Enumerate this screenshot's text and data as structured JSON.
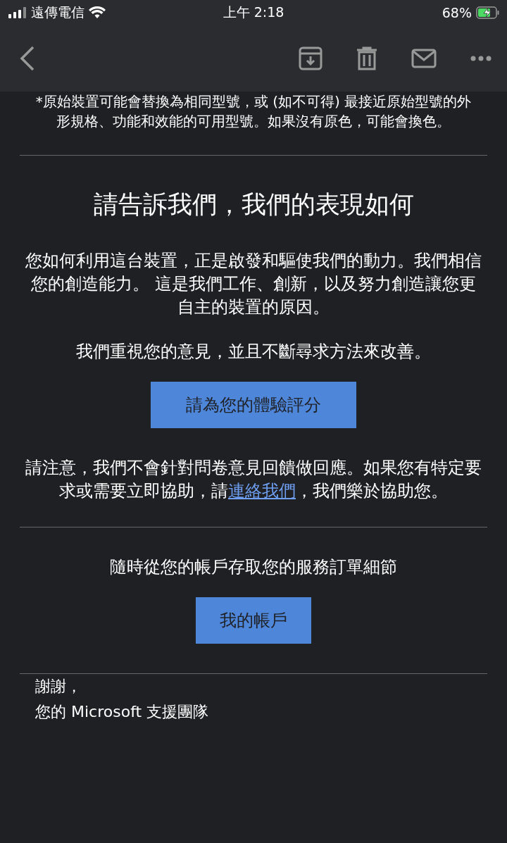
{
  "status_bar": {
    "carrier": "遠傳電信",
    "time": "上午 2:18",
    "battery": "68%"
  },
  "email": {
    "footnote": "*原始裝置可能會替換為相同型號，或 (如不可得) 最接近原始型號的外形規格、功能和效能的可用型號。如果沒有原色，可能會換色。",
    "survey_title": "請告訴我們，我們的表現如何",
    "survey_text": "您如何利用這台裝置，正是啟發和驅使我們的動力。我們相信您的創造能力。 這是我們工作、創新，以及努力創造讓您更自主的裝置的原因。",
    "survey_text_2": "我們重視您的意見，並且不斷尋求方法來改善。",
    "rate_button": "請為您的體驗評分",
    "notice_before": "請注意，我們不會針對問卷意見回饋做回應。如果您有特定要求或需要立即協助，請",
    "notice_link": "連絡我們",
    "notice_after": "，我們樂於協助您。",
    "account_text": "隨時從您的帳戶存取您的服務訂單細節",
    "account_button": "我的帳戶",
    "signoff": "謝謝，",
    "signature": "您的 Microsoft 支援團隊"
  }
}
